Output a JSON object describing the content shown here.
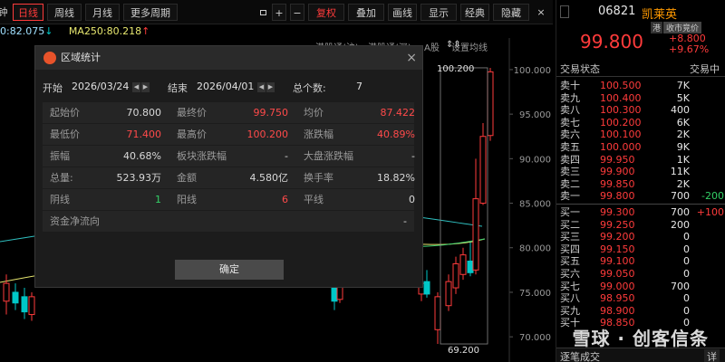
{
  "toolbar": {
    "items": [
      "日线",
      "周线",
      "月线",
      "更多周期",
      "复权",
      "叠加",
      "画线",
      "显示",
      "经典",
      "隐藏"
    ],
    "partial": "钟",
    "sym_plus": "+",
    "sym_minus": "−"
  },
  "ma": {
    "ma1": "0:82.075",
    "ma1_arrow": "↓",
    "ma250": "MA250:80.218",
    "ma250_arrow": "↑"
  },
  "chart": {
    "sub_tabs": [
      "港股通(沪)",
      "港股通(深)",
      "A股",
      "设置均线"
    ],
    "yticks": [
      "100.000",
      "95.000",
      "90.000",
      "85.000",
      "80.000",
      "75.000",
      "70.000"
    ],
    "high_label": "100.200",
    "low_label": "69.200",
    "double_arrows": "⇕⇕"
  },
  "dialog": {
    "title": "区域统计",
    "start_label": "开始",
    "start_date": "2026/03/24",
    "end_label": "结束",
    "end_date": "2026/04/01",
    "count_label": "总个数:",
    "count_value": "7",
    "ok_button": "确定",
    "close": "×",
    "rows": [
      [
        {
          "l": "起始价",
          "v": "70.800",
          "c": "w"
        },
        {
          "l": "最终价",
          "v": "99.750",
          "c": "r"
        },
        {
          "l": "均价",
          "v": "87.422",
          "c": "r"
        }
      ],
      [
        {
          "l": "最低价",
          "v": "71.400",
          "c": "r"
        },
        {
          "l": "最高价",
          "v": "100.200",
          "c": "r"
        },
        {
          "l": "涨跌幅",
          "v": "40.89%",
          "c": "r"
        }
      ],
      [
        {
          "l": "振幅",
          "v": "40.68%",
          "c": "w"
        },
        {
          "l": "板块涨跌幅",
          "v": "-",
          "c": "w"
        },
        {
          "l": "大盘涨跌幅",
          "v": "-",
          "c": "w"
        }
      ],
      [
        {
          "l": "总量:",
          "v": "523.93万",
          "c": "w"
        },
        {
          "l": "金额",
          "v": "4.580亿",
          "c": "w"
        },
        {
          "l": "换手率",
          "v": "18.82%",
          "c": "w"
        }
      ],
      [
        {
          "l": "阴线",
          "v": "1",
          "c": "g"
        },
        {
          "l": "阳线",
          "v": "6",
          "c": "r"
        },
        {
          "l": "平线",
          "v": "0",
          "c": "w"
        }
      ],
      [
        {
          "l": "资金净流向",
          "v": "-",
          "c": "w"
        }
      ]
    ]
  },
  "quote": {
    "code": "06821",
    "name": "凯莱英",
    "price": "99.800",
    "tag1": "港",
    "tag2": "收市竞价",
    "change": "+8.800",
    "pct": "+9.67%",
    "status_label": "交易状态",
    "status_value": "交易中",
    "more": "详",
    "footer": "逐笔成交"
  },
  "orderbook": {
    "sell": [
      [
        "卖十",
        "100.500",
        "7K",
        ""
      ],
      [
        "卖九",
        "100.400",
        "5K",
        ""
      ],
      [
        "卖八",
        "100.300",
        "400",
        ""
      ],
      [
        "卖七",
        "100.200",
        "6K",
        ""
      ],
      [
        "卖六",
        "100.100",
        "2K",
        ""
      ],
      [
        "卖五",
        "100.000",
        "9K",
        ""
      ],
      [
        "卖四",
        "99.950",
        "1K",
        ""
      ],
      [
        "卖三",
        "99.900",
        "11K",
        ""
      ],
      [
        "卖二",
        "99.850",
        "2K",
        ""
      ],
      [
        "卖一",
        "99.800",
        "700",
        "-200"
      ]
    ],
    "buy": [
      [
        "买一",
        "99.300",
        "700",
        "+100"
      ],
      [
        "买二",
        "99.250",
        "200",
        ""
      ],
      [
        "买三",
        "99.200",
        "0",
        ""
      ],
      [
        "买四",
        "99.150",
        "0",
        ""
      ],
      [
        "买五",
        "99.100",
        "0",
        ""
      ],
      [
        "买六",
        "99.050",
        "0",
        ""
      ],
      [
        "买七",
        "99.000",
        "700",
        ""
      ],
      [
        "买八",
        "98.950",
        "0",
        ""
      ],
      [
        "买九",
        "98.900",
        "0",
        ""
      ],
      [
        "买十",
        "98.850",
        "0",
        ""
      ]
    ]
  },
  "watermark": "雪球 · 创客信条",
  "colors": {
    "up": "#ff3b3b",
    "down": "#00c8c8",
    "accent_orange": "#ff9900"
  }
}
